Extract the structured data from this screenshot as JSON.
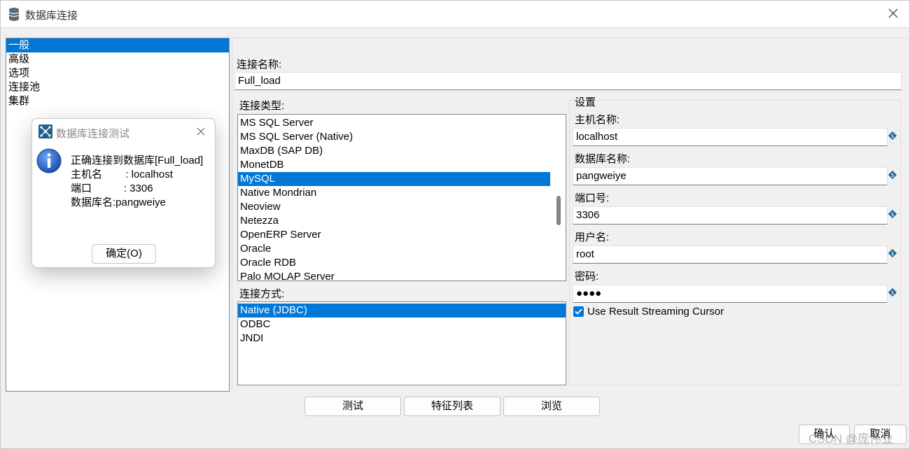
{
  "window": {
    "title": "数据库连接",
    "close_icon": "close-icon"
  },
  "nav": {
    "items": [
      "一般",
      "高级",
      "选项",
      "连接池",
      "集群"
    ],
    "selected": "一般"
  },
  "connection": {
    "name_label": "连接名称:",
    "name_value": "Full_load",
    "type_label": "连接类型:",
    "types": [
      "MS SQL Server",
      "MS SQL Server (Native)",
      "MaxDB (SAP DB)",
      "MonetDB",
      "MySQL",
      "Native Mondrian",
      "Neoview",
      "Netezza",
      "OpenERP Server",
      "Oracle",
      "Oracle RDB",
      "Palo MOLAP Server"
    ],
    "selected_type": "MySQL",
    "access_label": "连接方式:",
    "access_methods": [
      "Native (JDBC)",
      "ODBC",
      "JNDI"
    ],
    "selected_access": "Native (JDBC)"
  },
  "settings": {
    "group_title": "设置",
    "host_label": "主机名称:",
    "host_value": "localhost",
    "db_label": "数据库名称:",
    "db_value": "pangweiye",
    "port_label": "端口号:",
    "port_value": "3306",
    "user_label": "用户名:",
    "user_value": "root",
    "password_label": "密码:",
    "password_value": "●●●●",
    "streaming_label": "Use Result Streaming Cursor",
    "streaming_checked": true
  },
  "buttons": {
    "test": "测试",
    "features": "特征列表",
    "browse": "浏览",
    "ok": "确认",
    "cancel": "取消"
  },
  "dialog": {
    "title": "数据库连接测试",
    "line1": "正确连接到数据库[Full_load]",
    "line2": "主机名        : localhost",
    "line3": "端口           : 3306",
    "line4": "数据库名:pangweiye",
    "ok_label": "确定(O)"
  },
  "watermark": "CSDN @庞伟业",
  "colors": {
    "selection": "#0078d7",
    "variable_icon": "#1f5f8b"
  }
}
